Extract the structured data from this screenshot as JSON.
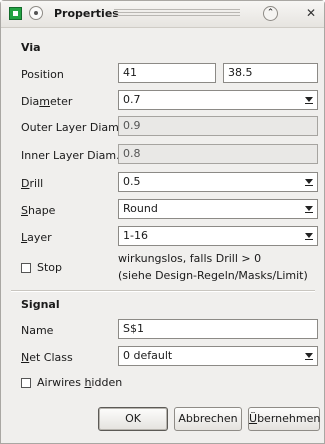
{
  "window": {
    "title": "Properties",
    "icons": [
      "app-icon",
      "window-menu-icon",
      "collapse-icon",
      "close-icon"
    ],
    "accent_green": "#23a242"
  },
  "via": {
    "header": "Via",
    "position_label": "Position",
    "position_x": "41",
    "position_y": "38.5",
    "diameter_pre": "Dia",
    "diameter_u": "m",
    "diameter_post": "eter",
    "diameter_value": "0.7",
    "outer_label": "Outer Layer Diam.",
    "outer_value": "0.9",
    "inner_label": "Inner Layer Diam.",
    "inner_value": "0.8",
    "drill_u": "D",
    "drill_post": "rill",
    "drill_value": "0.5",
    "shape_u": "S",
    "shape_post": "hape",
    "shape_value": "Round",
    "layer_u": "L",
    "layer_post": "ayer",
    "layer_value": "1-16",
    "stop_label": "Stop",
    "stop_checked": false,
    "note_line1": "wirkungslos, falls Drill > 0",
    "note_line2": "(siehe Design-Regeln/Masks/Limit)"
  },
  "signal": {
    "header": "Signal",
    "name_label": "Name",
    "name_value": "S$1",
    "netclass_u": "N",
    "netclass_post": "et Class",
    "netclass_value": "0 default",
    "airwires_pre": "Airwires ",
    "airwires_u": "h",
    "airwires_post": "idden",
    "airwires_checked": false
  },
  "buttons": {
    "ok": "OK",
    "cancel": "Abbrechen",
    "apply_u": "Ü",
    "apply_post": "bernehmen"
  }
}
